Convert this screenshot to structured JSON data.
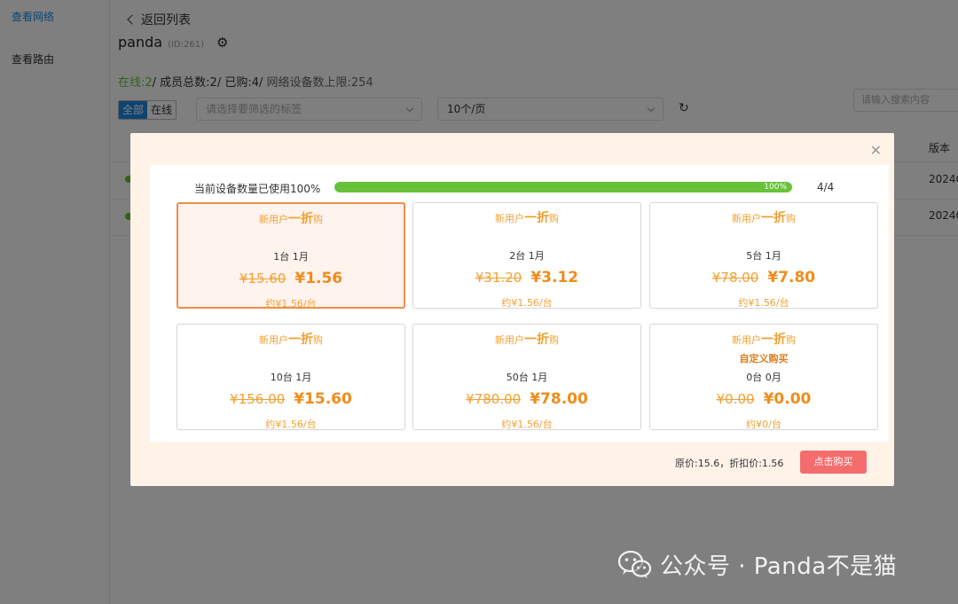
{
  "sidebar": {
    "items": [
      {
        "label": "查看网络",
        "active": true
      },
      {
        "label": "查看路由",
        "active": false
      }
    ]
  },
  "header": {
    "back_label": "返回列表",
    "network_name": "panda",
    "network_id": "(ID:261)",
    "stats": {
      "online": "在线:2",
      "members": "/ 成员总数:2/ 已购:4/",
      "limit": " 网络设备数上限:254"
    }
  },
  "toolbar": {
    "filter_all": "全部",
    "filter_online": "在线",
    "tag_select_placeholder": "请选择要筛选的标签",
    "page_size": "10个/页",
    "search_placeholder": "请输入搜索内容"
  },
  "table": {
    "version_header": "版本",
    "rows": [
      {
        "version": "2024C"
      },
      {
        "version": "2024C"
      }
    ]
  },
  "modal": {
    "usage_label": "当前设备数量已使用100%",
    "usage_percent": 100,
    "usage_percent_text": "100%",
    "usage_ratio": "4/4",
    "plans": [
      {
        "promo_prefix": "新用户",
        "promo_big": "一折",
        "promo_suffix": "购",
        "spec": "1台  1月",
        "original": "¥15.60",
        "discount": "¥1.56",
        "per_unit": "约¥1.56/台",
        "selected": true,
        "custom": ""
      },
      {
        "promo_prefix": "新用户",
        "promo_big": "一折",
        "promo_suffix": "购",
        "spec": "2台  1月",
        "original": "¥31.20",
        "discount": "¥3.12",
        "per_unit": "约¥1.56/台",
        "selected": false,
        "custom": ""
      },
      {
        "promo_prefix": "新用户",
        "promo_big": "一折",
        "promo_suffix": "购",
        "spec": "5台  1月",
        "original": "¥78.00",
        "discount": "¥7.80",
        "per_unit": "约¥1.56/台",
        "selected": false,
        "custom": ""
      },
      {
        "promo_prefix": "新用户",
        "promo_big": "一折",
        "promo_suffix": "购",
        "spec": "10台  1月",
        "original": "¥156.00",
        "discount": "¥15.60",
        "per_unit": "约¥1.56/台",
        "selected": false,
        "custom": ""
      },
      {
        "promo_prefix": "新用户",
        "promo_big": "一折",
        "promo_suffix": "购",
        "spec": "50台  1月",
        "original": "¥780.00",
        "discount": "¥78.00",
        "per_unit": "约¥1.56/台",
        "selected": false,
        "custom": ""
      },
      {
        "promo_prefix": "新用户",
        "promo_big": "一折",
        "promo_suffix": "购",
        "spec": "0台  0月",
        "original": "¥0.00",
        "discount": "¥0.00",
        "per_unit": "约¥0/台",
        "selected": false,
        "custom": "自定义购买"
      }
    ],
    "summary": "原价:15.6，折扣价:1.56",
    "buy_label": "点击购买"
  },
  "watermark": {
    "text": "公众号 · Panda不是猫"
  },
  "colors": {
    "accent_blue": "#1e88e5",
    "success_green": "#67c23a",
    "promo_orange": "#f0a030",
    "selected_border": "#f08c4a",
    "buy_red": "#f56c6c",
    "modal_bg": "#fff3e8"
  }
}
